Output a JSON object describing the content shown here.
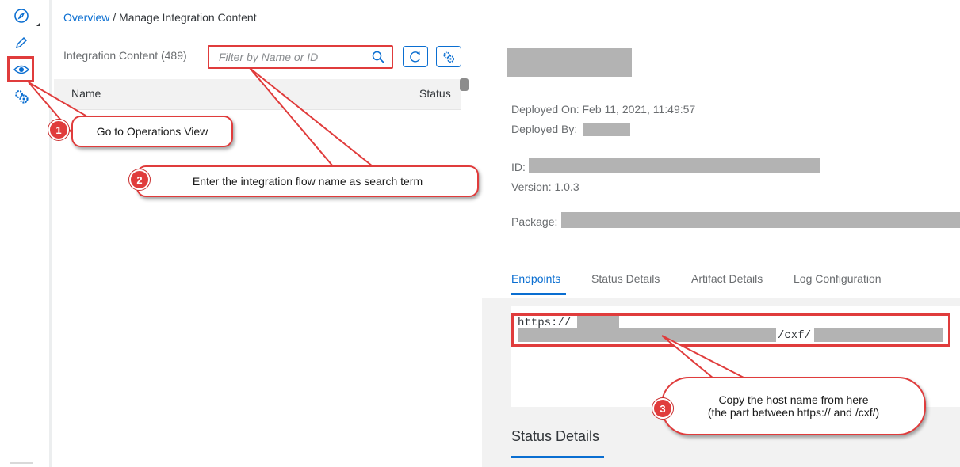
{
  "breadcrumb": {
    "link": "Overview",
    "separator": " / ",
    "current": "Manage Integration Content"
  },
  "nav": {
    "icons": [
      "compass-icon",
      "pencil-icon",
      "eye-icon",
      "gears-icon"
    ]
  },
  "list": {
    "title": "Integration Content (489)",
    "search_placeholder": "Filter by Name or ID",
    "columns": {
      "name": "Name",
      "status": "Status"
    }
  },
  "detail": {
    "deployed_on": "Deployed On: Feb 11, 2021, 11:49:57",
    "deployed_by": "Deployed By:",
    "id_label": "ID:",
    "version": "Version: 1.0.3",
    "package_label": "Package:",
    "tabs": [
      "Endpoints",
      "Status Details",
      "Artifact Details",
      "Log Configuration"
    ],
    "endpoint_prefix": "https://",
    "endpoint_mid": "/cxf/",
    "status_details_title": "Status Details"
  },
  "annotations": {
    "step1": {
      "number": "1",
      "text": "Go to Operations View"
    },
    "step2": {
      "number": "2",
      "text": "Enter the integration flow name as search term"
    },
    "step3": {
      "number": "3",
      "line1": "Copy the host name from here",
      "line2": "(the part between https:// and /cxf/)"
    }
  },
  "colors": {
    "accent": "#0a6ed1",
    "annotation": "#e03c3c",
    "redaction": "#b3b3b3"
  }
}
